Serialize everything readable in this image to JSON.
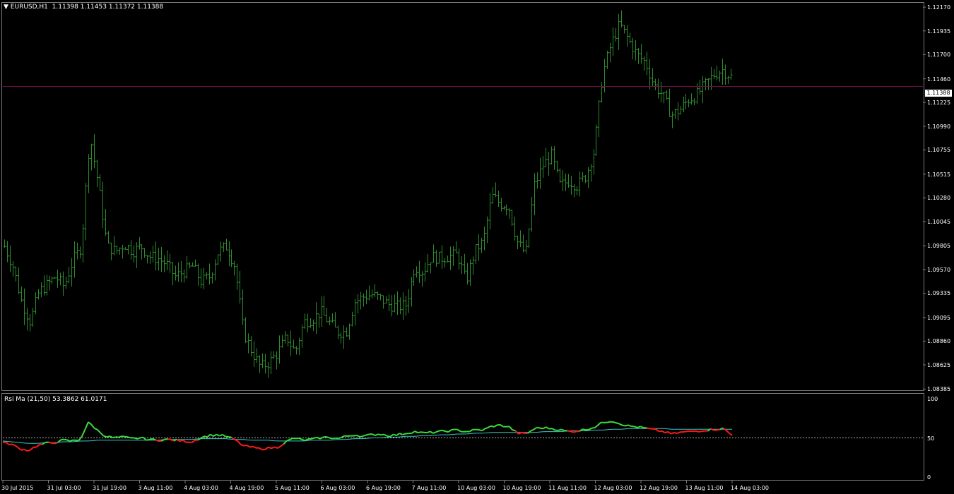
{
  "header": {
    "menu_icon": "triangle-down-icon",
    "symbol": "EURUSD,H1",
    "ohlc": "1.11398 1.11453 1.11372 1.11388"
  },
  "current_price": "1.11388",
  "indicator_label": "Rsi Ma (21,50) 53.3862 61.0171",
  "colors": {
    "bar": "#2e8b2e",
    "current_line": "#6b0f4a",
    "rsi_up": "#3cdc3c",
    "rsi_down": "#ff1a1a",
    "rsi_ma": "#3cc8c8",
    "level": "#b4b4b4",
    "axis": "#7a7a7a"
  },
  "chart_data": [
    {
      "type": "ohlc",
      "symbol": "EURUSD",
      "timeframe": "H1",
      "ylim": [
        1.0838,
        1.1222
      ],
      "yticks": [
        "1.12170",
        "1.11935",
        "1.11700",
        "1.11460",
        "1.11225",
        "1.10990",
        "1.10755",
        "1.10515",
        "1.10280",
        "1.10045",
        "1.09805",
        "1.09570",
        "1.09335",
        "1.09095",
        "1.08860",
        "1.08625",
        "1.08385"
      ],
      "xticks": [
        "30 Jul 2015",
        "31 Jul 03:00",
        "31 Jul 19:00",
        "3 Aug 11:00",
        "4 Aug 03:00",
        "4 Aug 19:00",
        "5 Aug 11:00",
        "6 Aug 03:00",
        "6 Aug 19:00",
        "7 Aug 11:00",
        "10 Aug 03:00",
        "10 Aug 19:00",
        "11 Aug 11:00",
        "12 Aug 03:00",
        "12 Aug 19:00",
        "13 Aug 11:00",
        "14 Aug 03:00"
      ],
      "anchors": [
        1.098,
        1.096,
        1.0925,
        1.0905,
        1.0935,
        1.0942,
        1.095,
        1.094,
        1.0965,
        1.098,
        1.109,
        1.104,
        1.098,
        1.0975,
        1.0982,
        1.0975,
        1.098,
        1.097,
        1.0968,
        1.0962,
        1.095,
        1.0955,
        1.096,
        1.0945,
        1.095,
        1.0975,
        1.098,
        1.096,
        1.0895,
        1.0875,
        1.086,
        1.0865,
        1.0875,
        1.089,
        1.0875,
        1.0905,
        1.0908,
        1.0915,
        1.0905,
        1.0895,
        1.0895,
        1.0925,
        1.093,
        1.0932,
        1.0928,
        1.0922,
        1.092,
        1.0922,
        1.096,
        1.0955,
        1.097,
        1.0968,
        1.097,
        1.0972,
        1.0945,
        1.0975,
        1.0985,
        1.103,
        1.1022,
        1.102,
        1.0985,
        1.0972,
        1.104,
        1.106,
        1.107,
        1.104,
        1.1045,
        1.104,
        1.105,
        1.1075,
        1.115,
        1.118,
        1.12,
        1.1185,
        1.117,
        1.1162,
        1.114,
        1.113,
        1.111,
        1.1115,
        1.1125,
        1.113,
        1.114,
        1.115,
        1.1155,
        1.1148
      ],
      "current_price": 1.11388
    },
    {
      "type": "line",
      "name": "Rsi Ma (21,50)",
      "rsi": 53.3862,
      "ma": 61.0171,
      "ylim": [
        0,
        100
      ],
      "yticks": [
        "100",
        "50",
        "0"
      ],
      "level": 50,
      "rsi_anchors": [
        44,
        42,
        36,
        34,
        40,
        43,
        44,
        47,
        46,
        48,
        70,
        60,
        52,
        50,
        51,
        49,
        50,
        48,
        47,
        48,
        47,
        46,
        45,
        50,
        53,
        54,
        52,
        48,
        40,
        38,
        36,
        37,
        38,
        45,
        50,
        47,
        48,
        50,
        51,
        49,
        52,
        54,
        52,
        54,
        55,
        53,
        54,
        56,
        58,
        56,
        57,
        58,
        59,
        60,
        58,
        60,
        60,
        65,
        66,
        64,
        56,
        55,
        62,
        63,
        62,
        60,
        58,
        59,
        61,
        64,
        70,
        72,
        68,
        65,
        64,
        62,
        60,
        58,
        55,
        57,
        58,
        59,
        60,
        61,
        62,
        53
      ],
      "ma_anchors": [
        46,
        45,
        44,
        43,
        43,
        44,
        44,
        45,
        45,
        46,
        46,
        47,
        47,
        47,
        47,
        47,
        47,
        47,
        47,
        48,
        48,
        48,
        48,
        49,
        49,
        49,
        49,
        48,
        48,
        47,
        47,
        47,
        46,
        46,
        46,
        46,
        47,
        47,
        47,
        48,
        48,
        49,
        49,
        50,
        50,
        51,
        51,
        52,
        52,
        53,
        53,
        54,
        54,
        55,
        55,
        56,
        56,
        57,
        57,
        57,
        57,
        57,
        57,
        58,
        58,
        58,
        59,
        59,
        59,
        60,
        60,
        61,
        61,
        62,
        62,
        62,
        62,
        62,
        61,
        61,
        61,
        61,
        61,
        61,
        61,
        61
      ]
    }
  ]
}
